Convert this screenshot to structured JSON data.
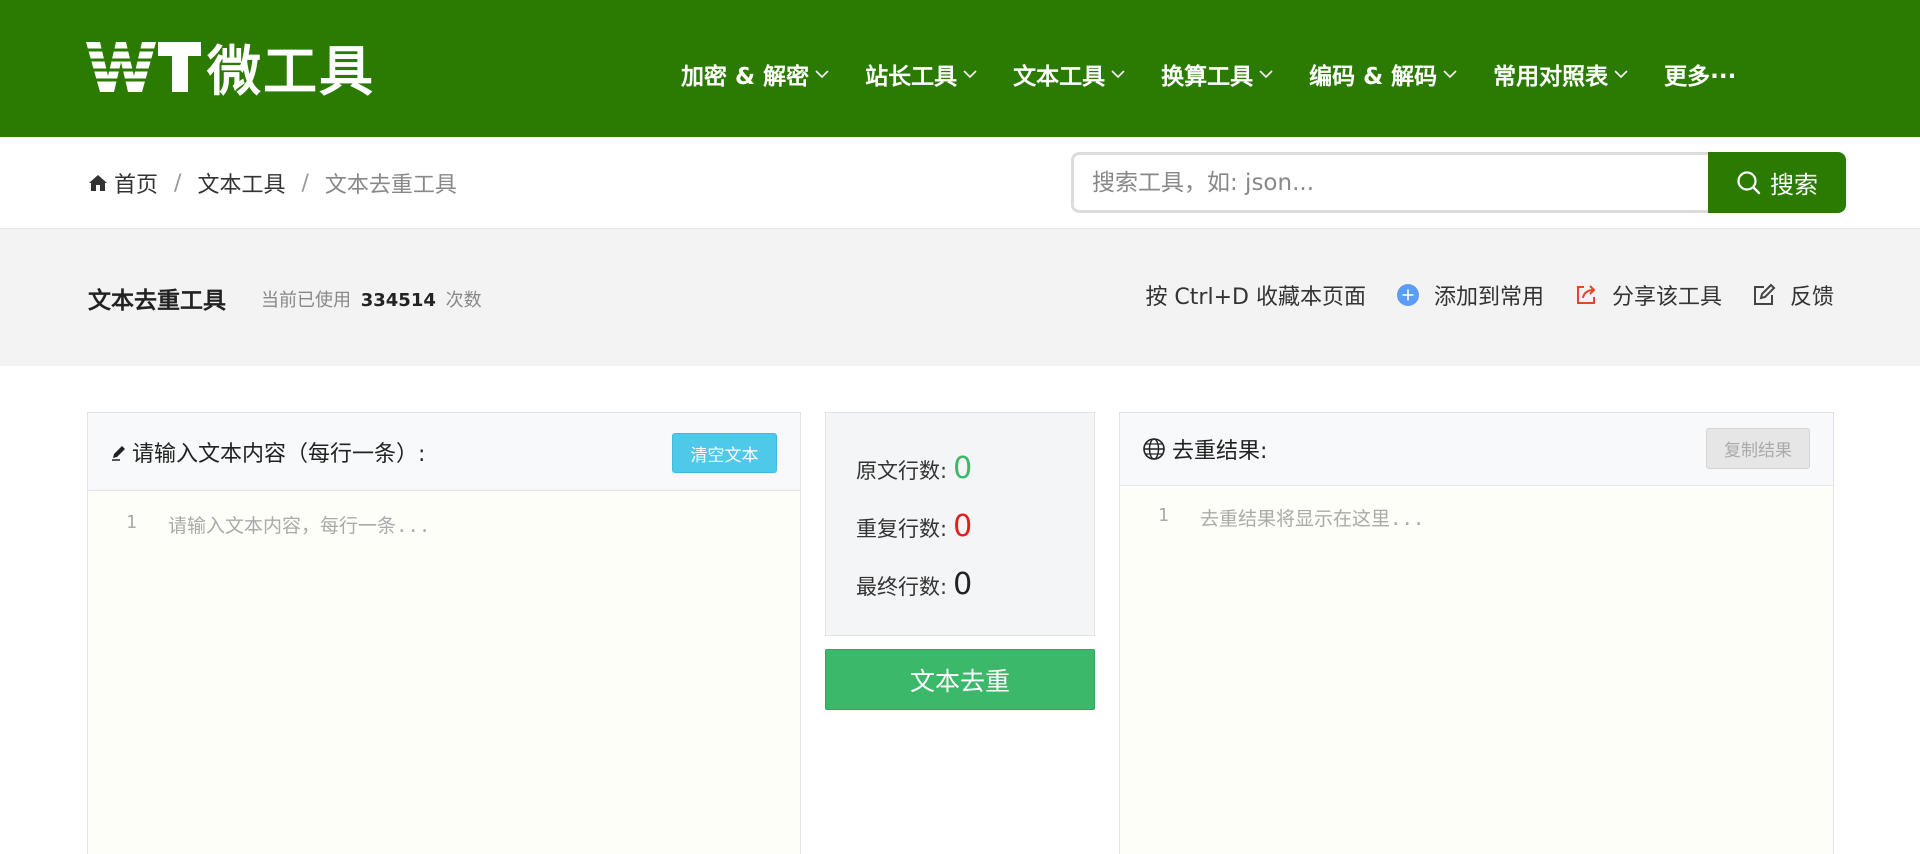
{
  "brand": {
    "logo_text": "微工具",
    "accent": "#2b7a02"
  },
  "nav": [
    {
      "label": "加密 & 解密",
      "has_dropdown": true
    },
    {
      "label": "站长工具",
      "has_dropdown": true
    },
    {
      "label": "文本工具",
      "has_dropdown": true
    },
    {
      "label": "换算工具",
      "has_dropdown": true
    },
    {
      "label": "编码 & 解码",
      "has_dropdown": true
    },
    {
      "label": "常用对照表",
      "has_dropdown": true
    },
    {
      "label": "更多···",
      "has_dropdown": false
    }
  ],
  "breadcrumb": {
    "home": "首页",
    "sep": "/",
    "section": "文本工具",
    "current": "文本去重工具"
  },
  "search": {
    "placeholder": "搜索工具，如: json...",
    "button_label": "搜索"
  },
  "tool": {
    "title": "文本去重工具",
    "usage_prefix": "当前已使用",
    "usage_count": "334514",
    "usage_suffix": "次数"
  },
  "actions": {
    "bookmark": "按 Ctrl+D 收藏本页面",
    "add_common": "添加到常用",
    "share": "分享该工具",
    "feedback": "反馈"
  },
  "input_panel": {
    "title": "请输入文本内容（每行一条）:",
    "clear_label": "清空文本",
    "line_number": "1",
    "placeholder": "请输入文本内容，每行一条..."
  },
  "stats": {
    "original_label": "原文行数:",
    "original_value": "0",
    "duplicate_label": "重复行数:",
    "duplicate_value": "0",
    "final_label": "最终行数:",
    "final_value": "0",
    "colors": {
      "original": "#3cb86a",
      "duplicate": "#e02020",
      "final": "#222222"
    }
  },
  "dedupe_button": "文本去重",
  "result_panel": {
    "title": "去重结果:",
    "copy_label": "复制结果",
    "line_number": "1",
    "placeholder": "去重结果将显示在这里..."
  }
}
